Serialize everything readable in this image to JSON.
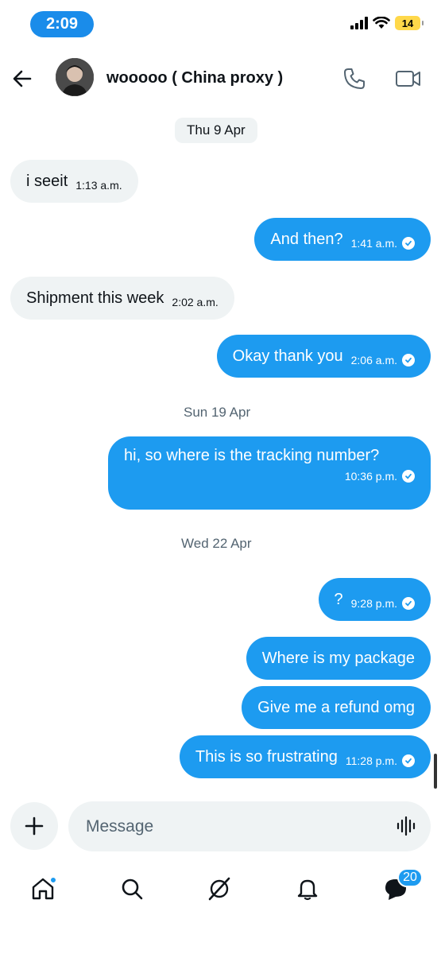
{
  "status_bar": {
    "time": "2:09",
    "battery": "14"
  },
  "header": {
    "contact_name": "wooooo ( China proxy )"
  },
  "dates": [
    "Thu 9 Apr",
    "Sun 19 Apr",
    "Wed 22 Apr"
  ],
  "messages": [
    {
      "direction": "in",
      "text": "i seeit",
      "time": "1:13 a.m."
    },
    {
      "direction": "out",
      "text": "And then?",
      "time": "1:41 a.m."
    },
    {
      "direction": "in",
      "text": "Shipment this week",
      "time": "2:02 a.m."
    },
    {
      "direction": "out",
      "text": "Okay thank you",
      "time": "2:06 a.m."
    },
    {
      "direction": "out",
      "text": "hi, so where is the tracking number?",
      "time": "10:36 p.m."
    },
    {
      "direction": "out",
      "text": "?",
      "time": "9:28 p.m."
    },
    {
      "direction": "out",
      "text": "Where is my package",
      "time": ""
    },
    {
      "direction": "out",
      "text": "Give me a refund omg",
      "time": ""
    },
    {
      "direction": "out",
      "text": "This is so frustrating",
      "time": "11:28 p.m."
    }
  ],
  "composer": {
    "placeholder": "Message"
  },
  "nav": {
    "messages_badge": "20"
  },
  "colors": {
    "accent": "#1d9bf0",
    "bubble_in": "#eff3f4",
    "time_pill": "#1a8cea"
  }
}
